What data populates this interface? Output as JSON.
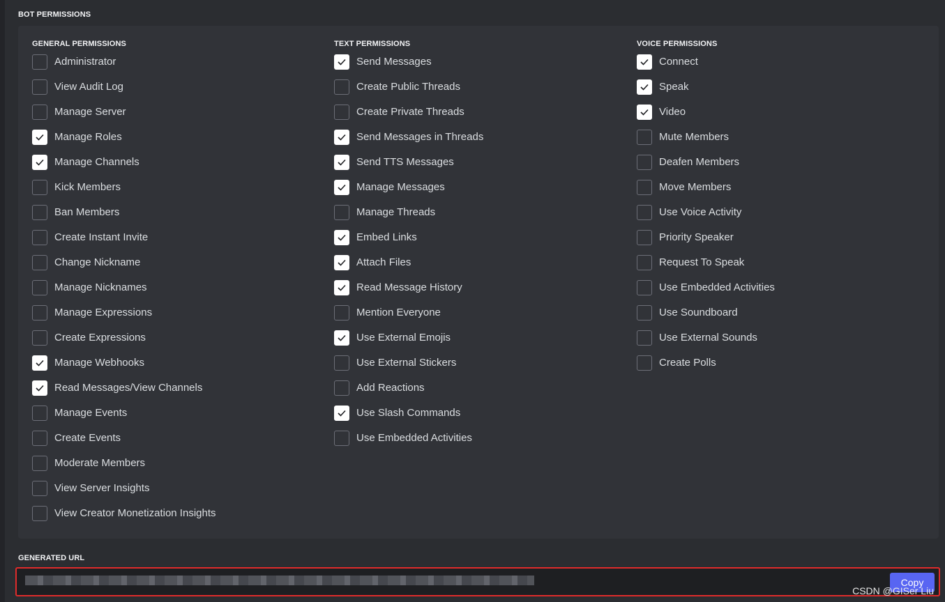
{
  "bot_permissions_label": "BOT PERMISSIONS",
  "columns": [
    {
      "title": "GENERAL PERMISSIONS",
      "items": [
        {
          "label": "Administrator",
          "checked": false
        },
        {
          "label": "View Audit Log",
          "checked": false
        },
        {
          "label": "Manage Server",
          "checked": false
        },
        {
          "label": "Manage Roles",
          "checked": true
        },
        {
          "label": "Manage Channels",
          "checked": true
        },
        {
          "label": "Kick Members",
          "checked": false
        },
        {
          "label": "Ban Members",
          "checked": false
        },
        {
          "label": "Create Instant Invite",
          "checked": false
        },
        {
          "label": "Change Nickname",
          "checked": false
        },
        {
          "label": "Manage Nicknames",
          "checked": false
        },
        {
          "label": "Manage Expressions",
          "checked": false
        },
        {
          "label": "Create Expressions",
          "checked": false
        },
        {
          "label": "Manage Webhooks",
          "checked": true
        },
        {
          "label": "Read Messages/View Channels",
          "checked": true
        },
        {
          "label": "Manage Events",
          "checked": false
        },
        {
          "label": "Create Events",
          "checked": false
        },
        {
          "label": "Moderate Members",
          "checked": false
        },
        {
          "label": "View Server Insights",
          "checked": false
        },
        {
          "label": "View Creator Monetization Insights",
          "checked": false
        }
      ]
    },
    {
      "title": "TEXT PERMISSIONS",
      "items": [
        {
          "label": "Send Messages",
          "checked": true
        },
        {
          "label": "Create Public Threads",
          "checked": false
        },
        {
          "label": "Create Private Threads",
          "checked": false
        },
        {
          "label": "Send Messages in Threads",
          "checked": true
        },
        {
          "label": "Send TTS Messages",
          "checked": true
        },
        {
          "label": "Manage Messages",
          "checked": true
        },
        {
          "label": "Manage Threads",
          "checked": false
        },
        {
          "label": "Embed Links",
          "checked": true
        },
        {
          "label": "Attach Files",
          "checked": true
        },
        {
          "label": "Read Message History",
          "checked": true
        },
        {
          "label": "Mention Everyone",
          "checked": false
        },
        {
          "label": "Use External Emojis",
          "checked": true
        },
        {
          "label": "Use External Stickers",
          "checked": false
        },
        {
          "label": "Add Reactions",
          "checked": false
        },
        {
          "label": "Use Slash Commands",
          "checked": true
        },
        {
          "label": "Use Embedded Activities",
          "checked": false
        }
      ]
    },
    {
      "title": "VOICE PERMISSIONS",
      "items": [
        {
          "label": "Connect",
          "checked": true
        },
        {
          "label": "Speak",
          "checked": true
        },
        {
          "label": "Video",
          "checked": true
        },
        {
          "label": "Mute Members",
          "checked": false
        },
        {
          "label": "Deafen Members",
          "checked": false
        },
        {
          "label": "Move Members",
          "checked": false
        },
        {
          "label": "Use Voice Activity",
          "checked": false
        },
        {
          "label": "Priority Speaker",
          "checked": false
        },
        {
          "label": "Request To Speak",
          "checked": false
        },
        {
          "label": "Use Embedded Activities",
          "checked": false
        },
        {
          "label": "Use Soundboard",
          "checked": false
        },
        {
          "label": "Use External Sounds",
          "checked": false
        },
        {
          "label": "Create Polls",
          "checked": false
        }
      ]
    }
  ],
  "generated_url_label": "GENERATED URL",
  "copy_label": "Copy",
  "watermark": "CSDN @GISer Liu",
  "colors": {
    "background": "#2b2d31",
    "panel": "#313338",
    "accent": "#5865f2",
    "highlight_border": "#e02b2b"
  }
}
